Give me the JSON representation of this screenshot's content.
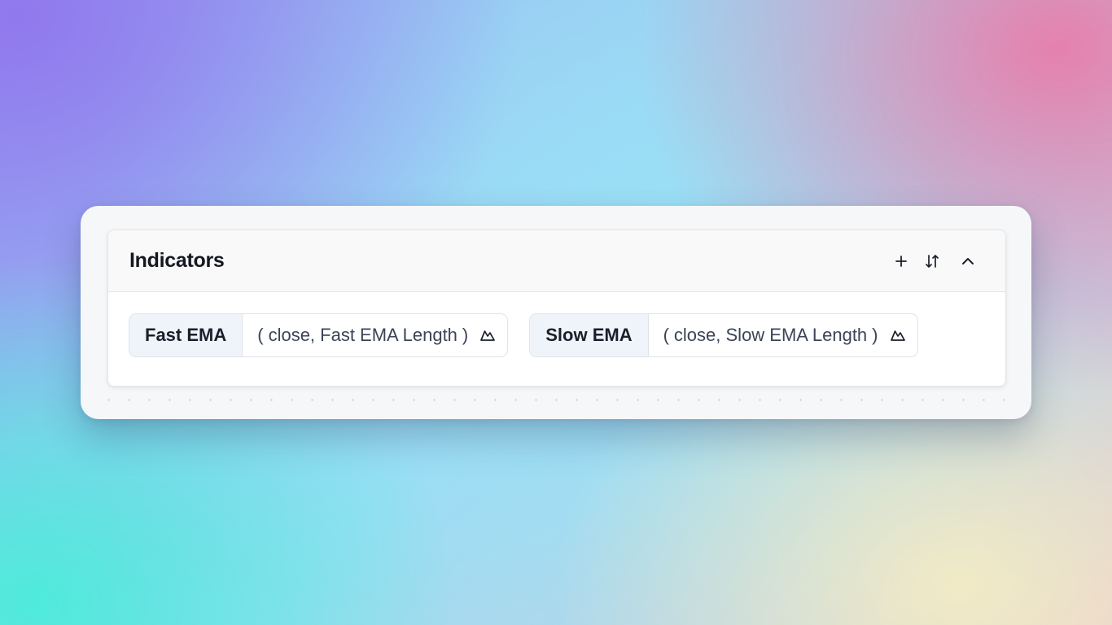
{
  "panel": {
    "title": "Indicators",
    "actions": {
      "add_icon": "plus-icon",
      "sort_icon": "sort-arrows-icon",
      "collapse_icon": "chevron-up-icon"
    }
  },
  "indicators": [
    {
      "name": "Fast EMA",
      "open_paren": "(",
      "args": "close, Fast EMA Length",
      "close_paren": ")",
      "icon": "chart-mountain-icon"
    },
    {
      "name": "Slow EMA",
      "open_paren": "(",
      "args": "close, Slow EMA Length",
      "close_paren": ")",
      "icon": "chart-mountain-icon"
    }
  ],
  "colors": {
    "title": "#141821",
    "chip_name_bg": "#eff3fa",
    "chip_border": "#dfe3ea"
  }
}
